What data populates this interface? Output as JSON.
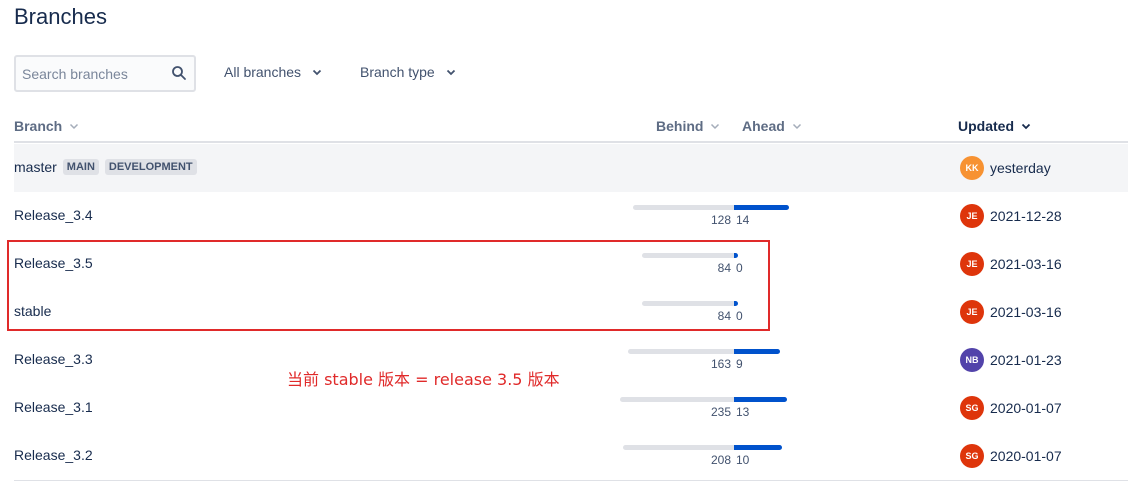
{
  "page": {
    "title": "Branches"
  },
  "search": {
    "placeholder": "Search branches"
  },
  "filters": {
    "all_branches": "All branches",
    "branch_type": "Branch type"
  },
  "columns": {
    "branch": "Branch",
    "behind": "Behind",
    "ahead": "Ahead",
    "updated": "Updated"
  },
  "colors": {
    "ahead_bar": "#0052cc",
    "behind_bar": "#dfe1e6",
    "annotation": "#e02a2a"
  },
  "rows": [
    {
      "name": "master",
      "lozenges": [
        "MAIN",
        "DEVELOPMENT"
      ],
      "avatar": "KK",
      "avatar_color": "#f79232",
      "updated": "yesterday"
    },
    {
      "name": "Release_3.4",
      "behind": "128",
      "ahead": "14",
      "avatar": "JE",
      "avatar_color": "#de350b",
      "updated": "2021-12-28"
    },
    {
      "name": "Release_3.5",
      "behind": "84",
      "ahead": "0",
      "avatar": "JE",
      "avatar_color": "#de350b",
      "updated": "2021-03-16"
    },
    {
      "name": "stable",
      "behind": "84",
      "ahead": "0",
      "avatar": "JE",
      "avatar_color": "#de350b",
      "updated": "2021-03-16"
    },
    {
      "name": "Release_3.3",
      "behind": "163",
      "ahead": "9",
      "avatar": "NB",
      "avatar_color": "#5243aa",
      "updated": "2021-01-23"
    },
    {
      "name": "Release_3.1",
      "behind": "235",
      "ahead": "13",
      "avatar": "SG",
      "avatar_color": "#de350b",
      "updated": "2020-01-07"
    },
    {
      "name": "Release_3.2",
      "behind": "208",
      "ahead": "10",
      "avatar": "SG",
      "avatar_color": "#de350b",
      "updated": "2020-01-07"
    }
  ],
  "annotation": {
    "text": "当前 stable 版本 = release 3.5 版本"
  }
}
